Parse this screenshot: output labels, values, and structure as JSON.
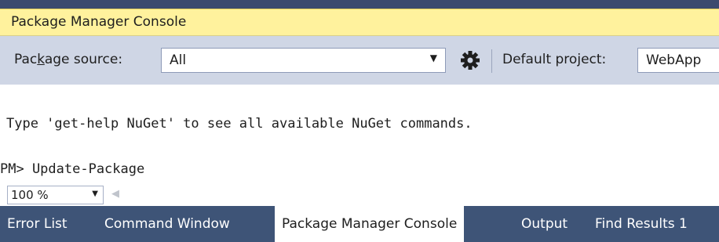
{
  "window": {
    "title": "Package Manager Console"
  },
  "toolbar": {
    "source_label_pre": "Pac",
    "source_label_acc": "k",
    "source_label_post": "age source:",
    "source_value": "All",
    "project_label_pre": "Default pro",
    "project_label_acc": "j",
    "project_label_post": "ect:",
    "project_value": "WebApp"
  },
  "icons": {
    "settings": "gear-icon",
    "dropdown": "chevron-down-icon",
    "scroll_left": "arrow-left-icon"
  },
  "console": {
    "lines": [
      "Type 'get-help NuGet' to see all available NuGet commands.",
      "PM> Update-Package"
    ]
  },
  "zoom": {
    "value": "100 %"
  },
  "tabs": [
    {
      "label": "Error List",
      "active": false
    },
    {
      "label": "Command Window",
      "active": false
    },
    {
      "label": "Package Manager Console",
      "active": true
    },
    {
      "label": "Output",
      "active": false
    },
    {
      "label": "Find Results 1",
      "active": false
    }
  ],
  "colors": {
    "title_bar": "#fff29d",
    "toolbar": "#cfd6e5",
    "tab_strip": "#3e5477",
    "active_tab": "#ffffff"
  }
}
